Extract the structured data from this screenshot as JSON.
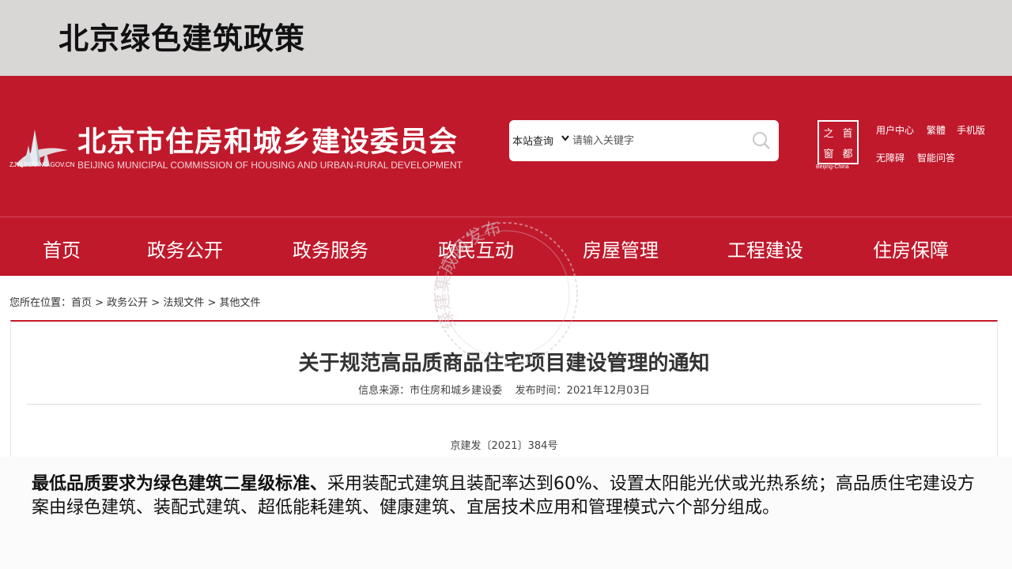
{
  "slide": {
    "title": "北京绿色建筑政策"
  },
  "header": {
    "logo_url": "ZJW.BEIJING.GOV.CN",
    "site_name": "北京市住房和城乡建设委员会",
    "site_name_en": "BEIJING MUNICIPAL COMMISSION OF HOUSING AND URBAN-RURAL DEVELOPMENT",
    "search": {
      "scope": "本站查询",
      "placeholder": "请输入关键字"
    },
    "seal": {
      "chars": [
        "之",
        "首",
        "窗",
        "都"
      ],
      "caption": "Beijing-China"
    },
    "links": [
      "用户中心",
      "繁體",
      "手机版",
      "无障碍",
      "智能问答"
    ]
  },
  "nav": {
    "items": [
      "首页",
      "政务公开",
      "政务服务",
      "政民互动",
      "房屋管理",
      "工程建设",
      "住房保障"
    ]
  },
  "breadcrumb": "您所在位置：首页 > 政务公开 > 法规文件 > 其他文件",
  "article": {
    "title": "关于规范高品质商品住宅项目建设管理的通知",
    "meta": "信息来源：市住房和城乡建设委    发布时间：2021年12月03日",
    "doc_number": "京建发〔2021〕384号"
  },
  "watermark": {
    "text": "绿建集成网发布"
  },
  "summary": {
    "bold": "最低品质要求为绿色建筑二星级标准、",
    "text": "采用装配式建筑且装配率达到60%、设置太阳能光伏或光热系统；高品质住宅建设方案由绿色建筑、装配式建筑、超低能耗建筑、健康建筑、宜居技术应用和管理模式六个部分组成。"
  },
  "colors": {
    "brand_red": "#c0192c",
    "title_bar": "#d9d6d6"
  }
}
